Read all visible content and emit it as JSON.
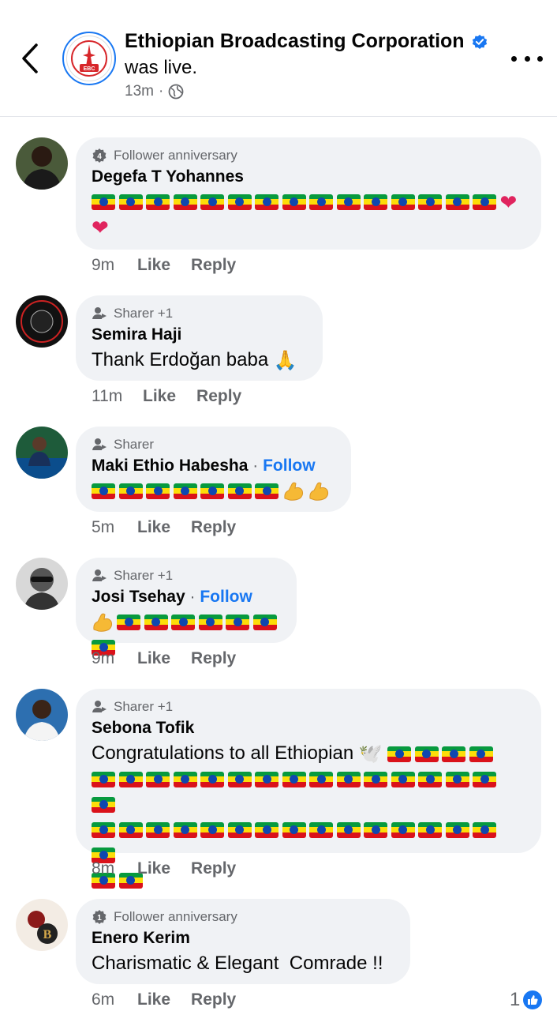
{
  "header": {
    "page_name": "Ethiopian Broadcasting Corporation",
    "subtitle": "was live.",
    "time": "13m",
    "separator": "·",
    "logo_text": "EBC"
  },
  "comments": [
    {
      "badge": "Follower anniversary",
      "author": "Degefa T Yohannes",
      "follow": "",
      "time": "9m",
      "like": "Like",
      "reply": "Reply"
    },
    {
      "badge": "Sharer +1",
      "author": "Semira Haji",
      "follow": "",
      "text": "Thank Erdoğan baba",
      "emoji": "🙏",
      "time": "11m",
      "like": "Like",
      "reply": "Reply"
    },
    {
      "badge": "Sharer",
      "author": "Maki Ethio Habesha",
      "follow": "Follow",
      "time": "5m",
      "like": "Like",
      "reply": "Reply"
    },
    {
      "badge": "Sharer +1",
      "author": "Josi Tsehay",
      "follow": "Follow",
      "time": "9m",
      "like": "Like",
      "reply": "Reply"
    },
    {
      "badge": "Sharer +1",
      "author": "Sebona Tofik",
      "follow": "",
      "text": "Congratulations to all Ethiopian",
      "emoji": "🕊️",
      "time": "8m",
      "like": "Like",
      "reply": "Reply"
    },
    {
      "badge": "Follower anniversary",
      "author": "Enero Kerim",
      "follow": "",
      "text": "Charismatic & Elegant  Comrade !!",
      "time": "6m",
      "like": "Like",
      "reply": "Reply",
      "reaction_count": "1"
    }
  ],
  "follow_separator": "·",
  "colors": {
    "accent": "#1877f2",
    "bubble": "#f0f2f5",
    "muted": "#65676b"
  },
  "icons": {
    "back": "chevron-left-icon",
    "verified": "verified-badge-icon",
    "globe": "globe-icon",
    "more": "more-dots-icon",
    "like": "thumbs-up-icon"
  }
}
